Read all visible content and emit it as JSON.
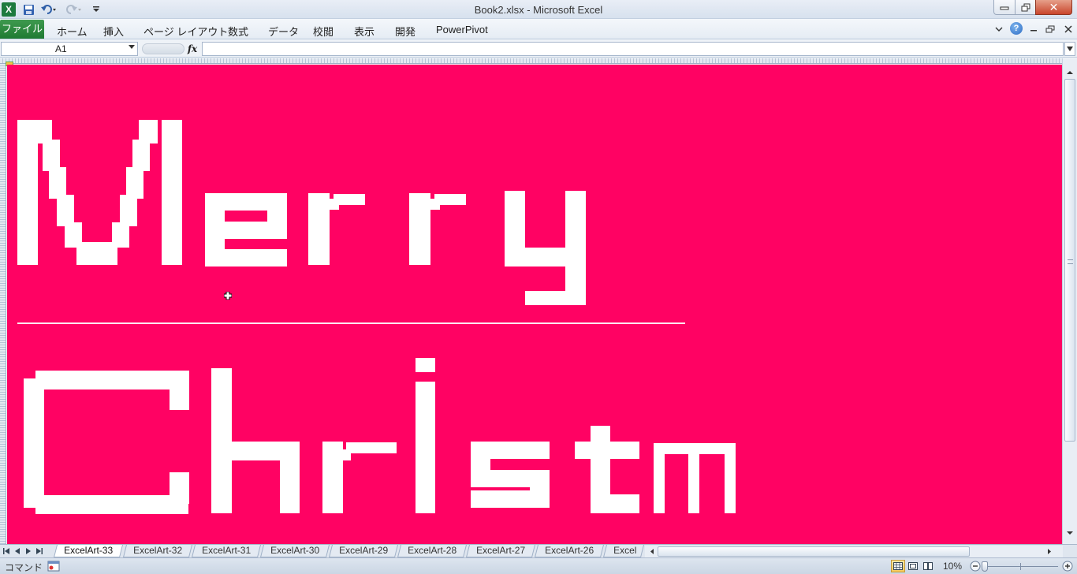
{
  "window": {
    "title": "Book2.xlsx  -  Microsoft Excel",
    "app_icon_letter": "X",
    "minimize_icon": "minimize-icon",
    "restore_icon": "restore-icon",
    "close_symbol": "✕"
  },
  "quick_access": {
    "icons": [
      "excel-logo-icon",
      "save-icon",
      "undo-icon",
      "redo-icon",
      "customize-quick-access-icon"
    ]
  },
  "ribbon": {
    "file_tab": "ファイル",
    "tabs": [
      "ホーム",
      "挿入",
      "ページ レイアウト",
      "数式",
      "データ",
      "校閲",
      "表示",
      "開発",
      "PowerPivot"
    ],
    "help_label": "?"
  },
  "formula_bar": {
    "name_box": "A1",
    "fx_label": "fx",
    "formula": ""
  },
  "sheet": {
    "background_color": "#ff0263",
    "art_color": "#ffffff",
    "art_text_line1": "Merry",
    "art_text_line2": "Christm"
  },
  "sheet_tabs": [
    "ExcelArt-33",
    "ExcelArt-32",
    "ExcelArt-31",
    "ExcelArt-30",
    "ExcelArt-29",
    "ExcelArt-28",
    "ExcelArt-27",
    "ExcelArt-26",
    "Excel"
  ],
  "active_sheet_tab": "ExcelArt-33",
  "status_bar": {
    "mode": "コマンド",
    "zoom": "10%"
  }
}
